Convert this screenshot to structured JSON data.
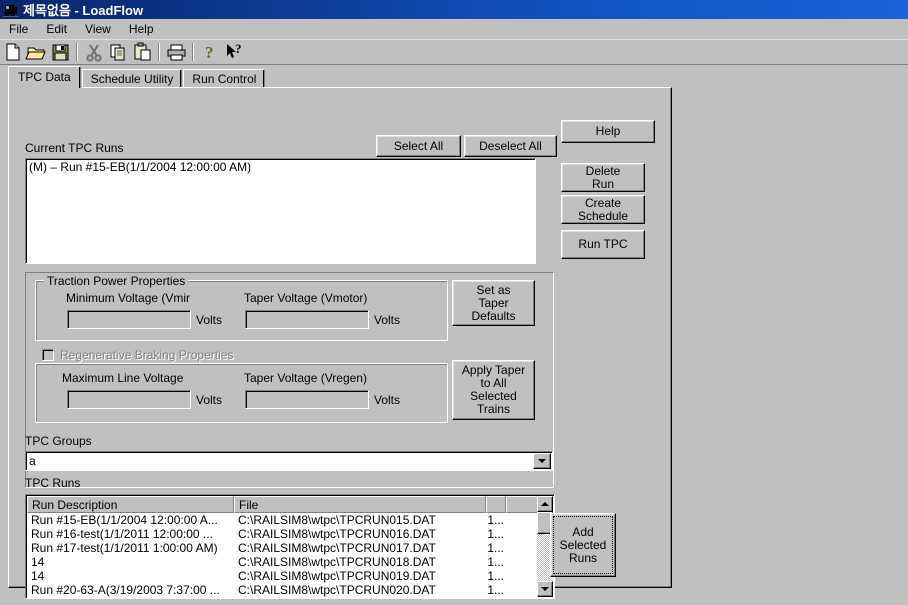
{
  "window": {
    "title": "제목없음 - LoadFlow",
    "icon": "train-icon"
  },
  "menu": {
    "items": [
      {
        "label": "File"
      },
      {
        "label": "Edit"
      },
      {
        "label": "View"
      },
      {
        "label": "Help"
      }
    ]
  },
  "toolbar": {
    "buttons": [
      {
        "name": "new-icon",
        "title": "New"
      },
      {
        "name": "open-icon",
        "title": "Open"
      },
      {
        "name": "save-icon",
        "title": "Save"
      },
      {
        "name": "cut-icon",
        "title": "Cut"
      },
      {
        "name": "copy-icon",
        "title": "Copy"
      },
      {
        "name": "paste-icon",
        "title": "Paste"
      },
      {
        "name": "print-icon",
        "title": "Print"
      },
      {
        "name": "about-icon",
        "title": "About"
      },
      {
        "name": "context-help-icon",
        "title": "Context Help"
      }
    ]
  },
  "tabs": [
    {
      "label": "TPC Data",
      "active": true
    },
    {
      "label": "Schedule Utility",
      "active": false
    },
    {
      "label": "Run Control",
      "active": false
    }
  ],
  "main": {
    "current_runs_label": "Current TPC Runs",
    "select_all_label": "Select All",
    "deselect_all_label": "Deselect All",
    "help_label": "Help",
    "delete_run_label": "Delete\nRun",
    "delete_run_line1": "Delete",
    "delete_run_line2": "Run",
    "create_schedule_line1": "Create",
    "create_schedule_line2": "Schedule",
    "run_tpc_label": "Run TPC",
    "current_runs_items": [
      "(M) – Run #15-EB(1/1/2004 12:00:00 AM)"
    ]
  },
  "traction": {
    "group_title": "Traction Power Properties",
    "min_voltage_label": "Minimum Voltage (Vmir",
    "min_voltage_value": "",
    "min_voltage_unit": "Volts",
    "taper_voltage_label": "Taper Voltage (Vmotor)",
    "taper_voltage_value": "",
    "taper_voltage_unit": "Volts",
    "set_taper_line1": "Set as",
    "set_taper_line2": "Taper",
    "set_taper_line3": "Defaults"
  },
  "regen": {
    "group_title": "Regenerative Braking Properties",
    "checked": false,
    "enabled": false,
    "max_line_voltage_label": "Maximum Line Voltage",
    "max_line_voltage_value": "",
    "max_line_voltage_unit": "Volts",
    "taper_voltage_label": "Taper Voltage (Vregen)",
    "taper_voltage_value": "",
    "taper_voltage_unit": "Volts",
    "apply_taper_line1": "Apply Taper",
    "apply_taper_line2": "to All",
    "apply_taper_line3": "Selected",
    "apply_taper_line4": "Trains"
  },
  "groups": {
    "label": "TPC Groups",
    "selected": "a"
  },
  "runs": {
    "label": "TPC Runs",
    "columns": [
      "Run Description",
      "File",
      "",
      "",
      ""
    ],
    "rows": [
      {
        "description": "Run #15-EB(1/1/2004 12:00:00 A...",
        "file": "C:\\RAILSIM8\\wtpc\\TPCRUN015.DAT",
        "col3": "1..."
      },
      {
        "description": "Run #16-test(1/1/2011 12:00:00 ...",
        "file": "C:\\RAILSIM8\\wtpc\\TPCRUN016.DAT",
        "col3": "1..."
      },
      {
        "description": "Run #17-test(1/1/2011 1:00:00 AM)",
        "file": "C:\\RAILSIM8\\wtpc\\TPCRUN017.DAT",
        "col3": "1..."
      },
      {
        "description": "14",
        "file": "C:\\RAILSIM8\\wtpc\\TPCRUN018.DAT",
        "col3": "1..."
      },
      {
        "description": "14",
        "file": "C:\\RAILSIM8\\wtpc\\TPCRUN019.DAT",
        "col3": "1..."
      },
      {
        "description": "Run #20-63-A(3/19/2003 7:37:00 ...",
        "file": "C:\\RAILSIM8\\wtpc\\TPCRUN020.DAT",
        "col3": "1..."
      }
    ],
    "add_selected_line1": "Add",
    "add_selected_line2": "Selected",
    "add_selected_line3": "Runs"
  },
  "colors": {
    "title_bar": "#0a246a",
    "face": "#c0c0c0",
    "shadow": "#808080",
    "highlight": "#ffffff",
    "window_bg": "#ffffff",
    "disabled_text": "#808080"
  }
}
